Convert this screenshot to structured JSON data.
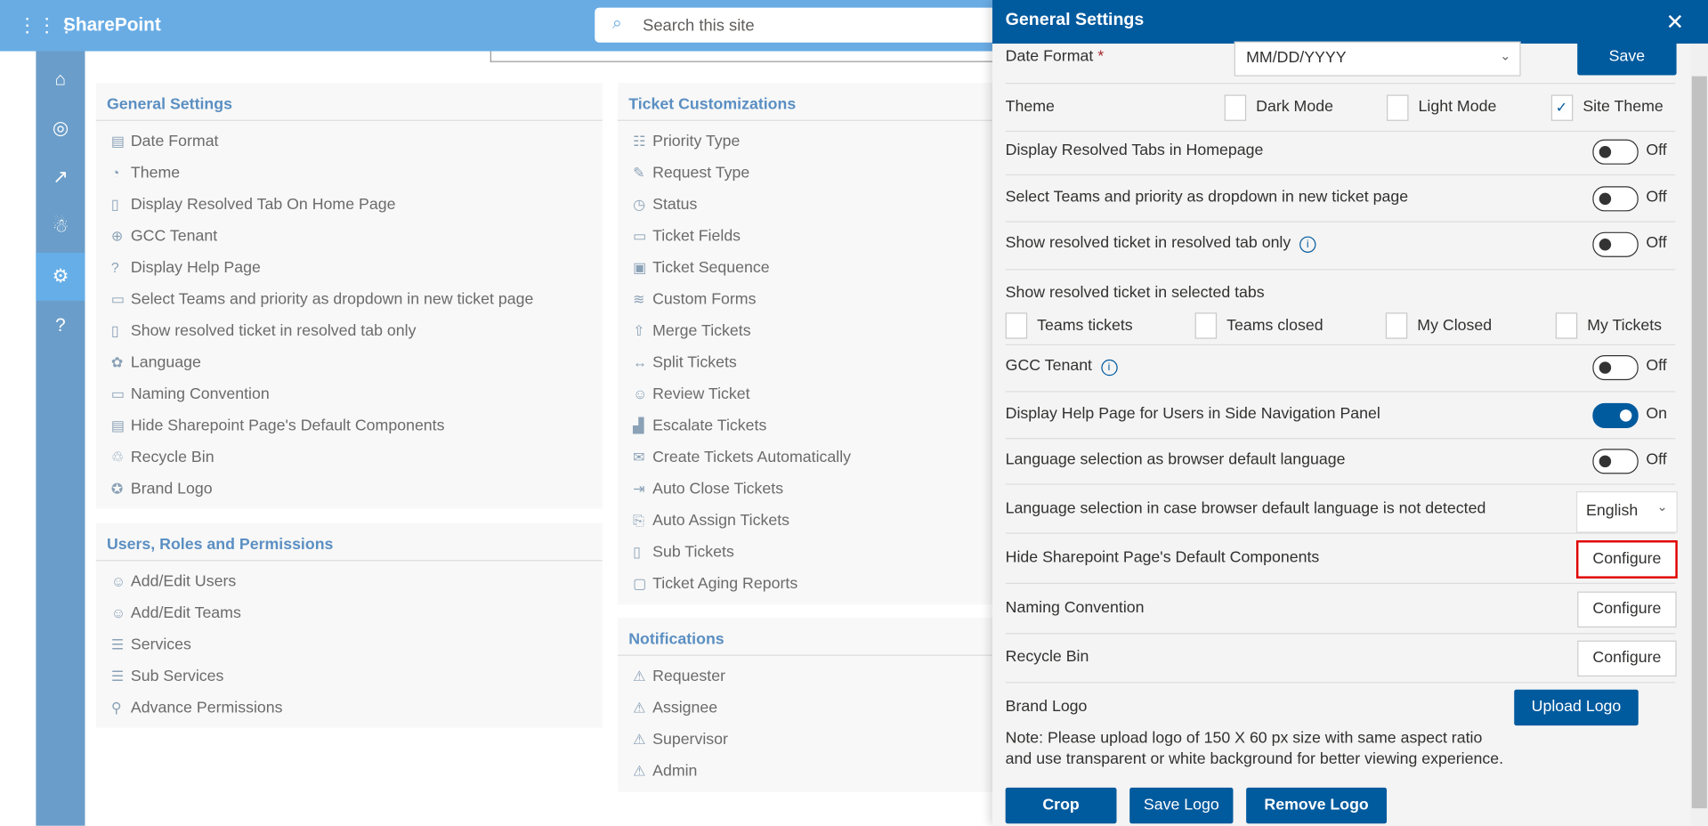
{
  "app": {
    "title": "SharePoint",
    "search_placeholder": "Search this site"
  },
  "rail": [
    "home-icon",
    "dashboard-icon",
    "analytics-icon",
    "users-icon",
    "settings-icon",
    "help-icon"
  ],
  "cards": {
    "general": {
      "title": "General Settings",
      "items": [
        "Date Format",
        "Theme",
        "Display Resolved Tab On Home Page",
        "GCC Tenant",
        "Display Help Page",
        "Select Teams and priority as dropdown in new ticket page",
        "Show resolved ticket in resolved tab only",
        "Language",
        "Naming Convention",
        "Hide Sharepoint Page's Default Components",
        "Recycle Bin",
        "Brand Logo"
      ]
    },
    "users": {
      "title": "Users, Roles and Permissions",
      "items": [
        "Add/Edit Users",
        "Add/Edit Teams",
        "Services",
        "Sub Services",
        "Advance Permissions"
      ]
    },
    "tickets": {
      "title": "Ticket Customizations",
      "items": [
        "Priority Type",
        "Request Type",
        "Status",
        "Ticket Fields",
        "Ticket Sequence",
        "Custom Forms",
        "Merge Tickets",
        "Split Tickets",
        "Review Ticket",
        "Escalate Tickets",
        "Create Tickets Automatically",
        "Auto Close Tickets",
        "Auto Assign Tickets",
        "Sub Tickets",
        "Ticket Aging Reports"
      ]
    },
    "notifications": {
      "title": "Notifications",
      "items": [
        "Requester",
        "Assignee",
        "Supervisor",
        "Admin"
      ]
    }
  },
  "panel": {
    "title": "General Settings",
    "date_format_label": "Date Format",
    "required": "*",
    "date_format_value": "MM/DD/YYYY",
    "save": "Save",
    "theme_label": "Theme",
    "theme_options": [
      {
        "label": "Dark Mode",
        "checked": false
      },
      {
        "label": "Light Mode",
        "checked": false
      },
      {
        "label": "Site Theme",
        "checked": true
      }
    ],
    "toggles": [
      {
        "label": "Display Resolved Tabs in Homepage",
        "state": "Off"
      },
      {
        "label": "Select Teams and priority as dropdown in new ticket page",
        "state": "Off"
      },
      {
        "label": "Show resolved ticket in resolved tab only",
        "state": "Off"
      }
    ],
    "selected_tabs_label": "Show resolved ticket in selected tabs",
    "tab_options": [
      {
        "label": "Teams tickets",
        "checked": false
      },
      {
        "label": "Teams closed",
        "checked": false
      },
      {
        "label": "My Closed",
        "checked": false
      },
      {
        "label": "My Tickets",
        "checked": false
      }
    ],
    "toggles2": [
      {
        "label": "GCC Tenant",
        "state": "Off"
      },
      {
        "label": "Display Help Page for Users in Side Navigation Panel",
        "state": "On"
      },
      {
        "label": "Language selection as browser default language",
        "state": "Off"
      }
    ],
    "lang_label": "Language selection in case browser default language is not detected",
    "lang_value": "English",
    "configure_rows": [
      {
        "label": "Hide Sharepoint Page's Default Components",
        "button": "Configure"
      },
      {
        "label": "Naming Convention",
        "button": "Configure"
      },
      {
        "label": "Recycle Bin",
        "button": "Configure"
      }
    ],
    "brand_logo_label": "Brand Logo",
    "upload": "Upload Logo",
    "note": "Note: Please upload logo of 150 X 60 px size with same aspect ratio and use transparent or white background for better viewing experience.",
    "crop": "Crop",
    "save_logo": "Save Logo",
    "remove_logo": "Remove Logo",
    "highlight_color": "#e00000",
    "accent": "#005a9e"
  }
}
